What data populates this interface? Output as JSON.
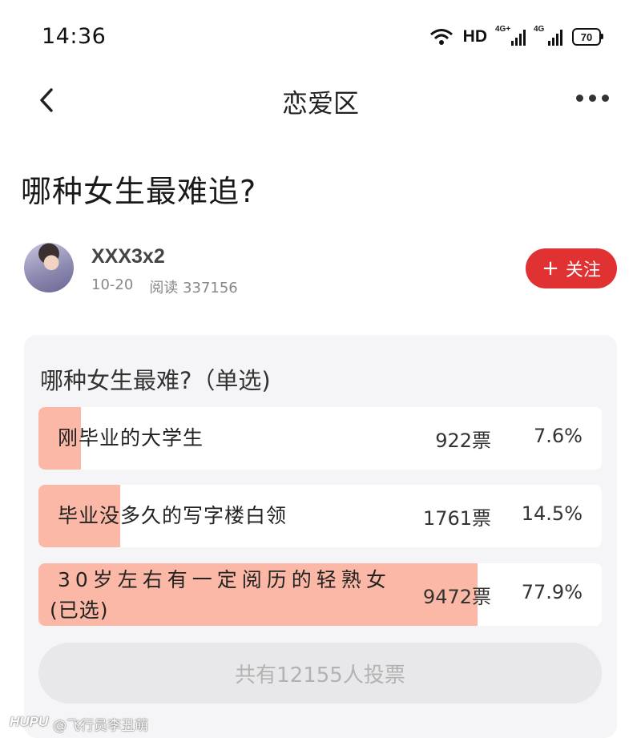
{
  "status": {
    "time": "14:36",
    "hd": "HD",
    "network1": "4G+",
    "network2": "4G",
    "battery": "70"
  },
  "nav": {
    "title": "恋爱区"
  },
  "post": {
    "title": "哪种女生最难追?",
    "author": "XXX3x2",
    "date": "10-20",
    "reads": "阅读 337156",
    "follow_label": "关注",
    "follow_plus": "+"
  },
  "poll": {
    "question": "哪种女生最难?（单选)",
    "options": [
      {
        "label": "刚毕业的大学生",
        "votes": "922票",
        "percent": "7.6%",
        "share": 7.6
      },
      {
        "label": "毕业没多久的写字楼白领",
        "votes": "1761票",
        "percent": "14.5%",
        "share": 14.5
      },
      {
        "label": "30岁左右有一定阅历的轻熟女",
        "selected_note": "(已选)",
        "votes": "9472票",
        "percent": "77.9%",
        "share": 77.9
      }
    ],
    "total": "共有12155人投票"
  },
  "watermark": {
    "brand": "HUPU",
    "handle": "@飞行员李丑萌"
  },
  "colors": {
    "accent": "#e03232",
    "poll_fill": "#fbb8a6",
    "card_bg": "#f5f5f7"
  }
}
